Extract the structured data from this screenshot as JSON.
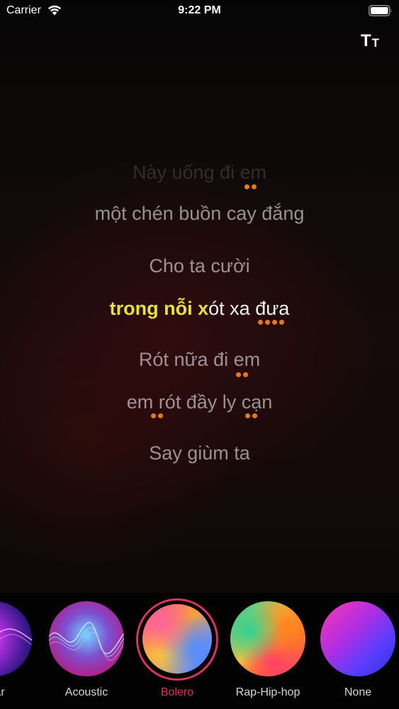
{
  "status_bar": {
    "carrier": "Carrier",
    "time": "9:22 PM",
    "wifi_icon": "wifi-icon",
    "battery_icon": "battery-full-icon"
  },
  "toolbar": {
    "font_size_icon": "text-size-icon",
    "font_size_big": "T",
    "font_size_small": "T"
  },
  "lyrics": {
    "lines": [
      "Này uống đi em",
      "một chén buồn cay đắng",
      "Cho ta cười",
      "Rót nữa đi em",
      "em rót đầy ly cạn",
      "Say giùm ta"
    ],
    "current_line": {
      "sung": "trong nỗi x",
      "unsung": "ót xa đưa"
    },
    "highlight_color": "#e5e03c",
    "dot_color": "#e8790e"
  },
  "effects": {
    "selected": "Bolero",
    "accent_color": "#d6335d",
    "items": [
      {
        "label": "Star"
      },
      {
        "label": "Acoustic"
      },
      {
        "label": "Bolero"
      },
      {
        "label": "Rap-Hip-hop"
      },
      {
        "label": "None"
      }
    ]
  }
}
